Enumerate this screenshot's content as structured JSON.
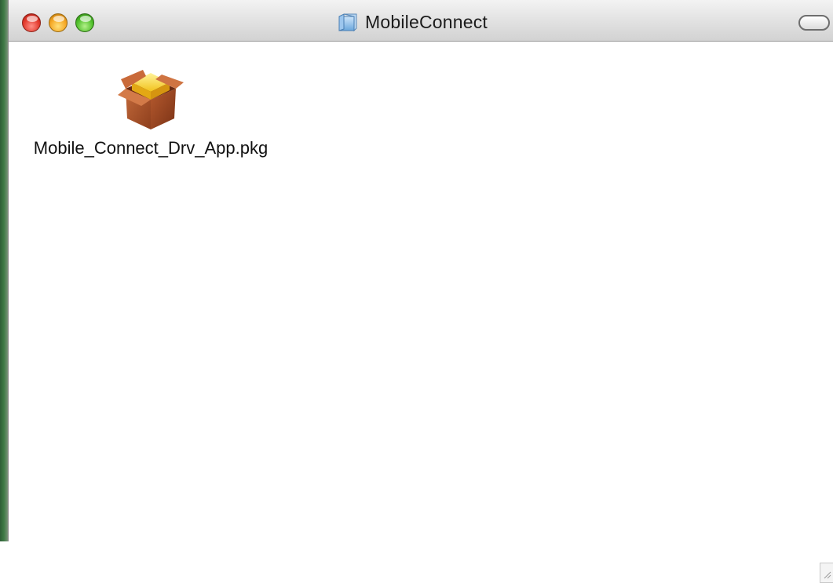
{
  "window": {
    "title": "MobileConnect",
    "folder_icon": "folder-icon"
  },
  "titlebar": {
    "buttons": [
      {
        "name": "close",
        "color": "#e2392c"
      },
      {
        "name": "minimize",
        "color": "#f5a623"
      },
      {
        "name": "zoom",
        "color": "#4fbf2a"
      }
    ],
    "toolbar_toggle_icon": "pill-toggle-icon"
  },
  "files": [
    {
      "name": "Mobile_Connect_Drv_App.pkg",
      "icon": "package-icon"
    }
  ],
  "colors": {
    "desktop_edge": "#3f7a46",
    "titlebar": "#e4e4e4",
    "content_background": "#ffffff"
  }
}
